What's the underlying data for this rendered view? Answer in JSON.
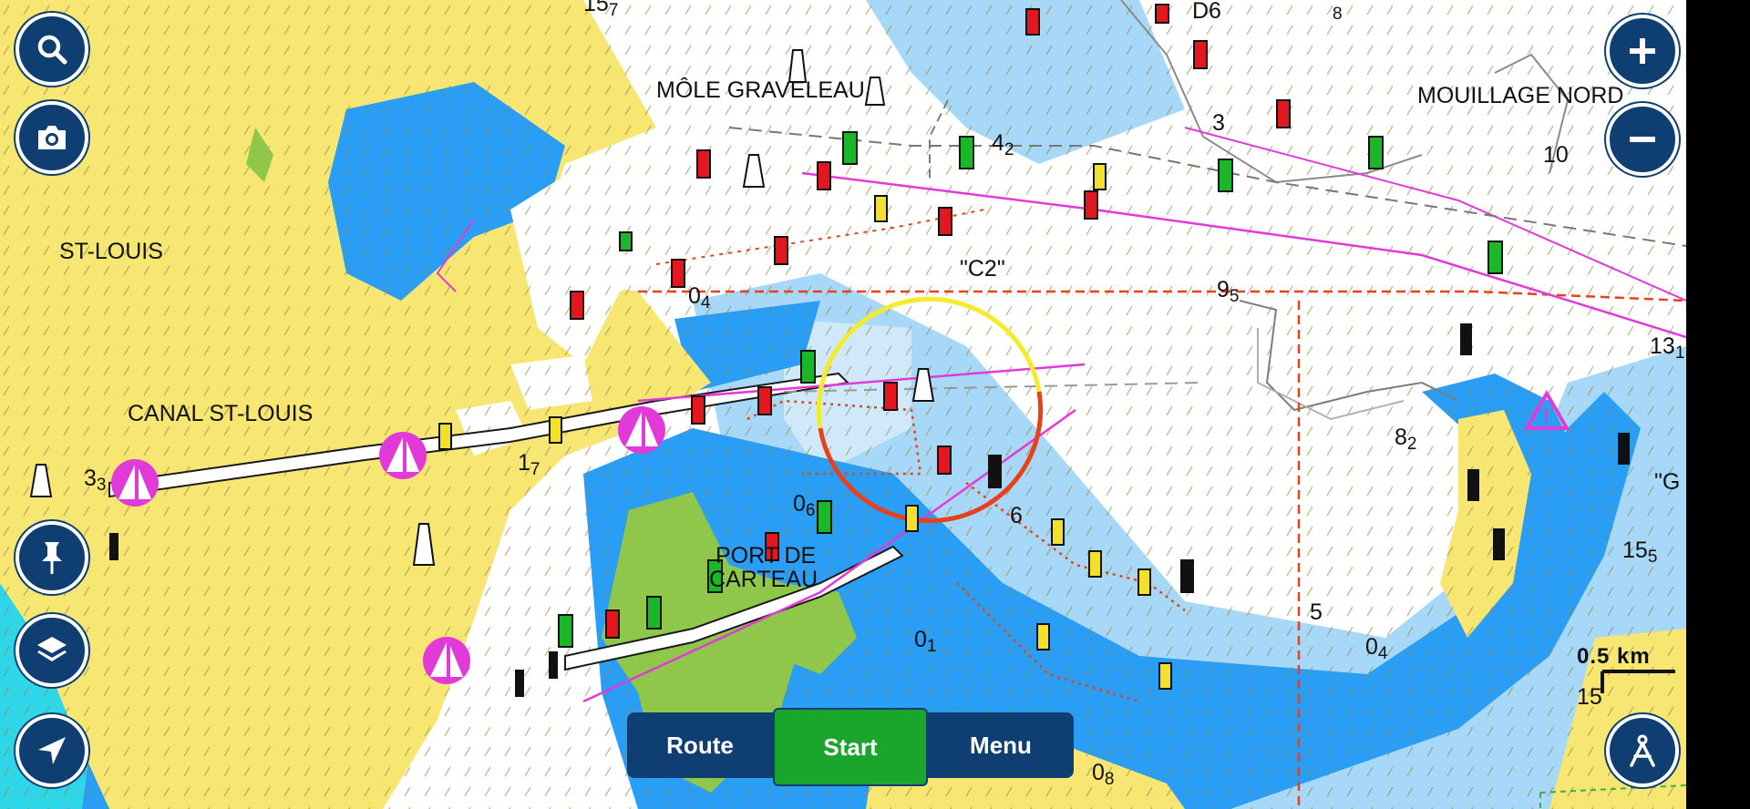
{
  "colors": {
    "land": "#f8e673",
    "shallow_water": "#2a9df4",
    "mid_water": "#a7d8f8",
    "deep_water": "#ffffff",
    "intertidal": "#8fc74a",
    "canal_cyan": "#2fd6e8",
    "button_navy": "#0f3f72",
    "start_green": "#1aa52c",
    "magenta": "#e23ad9",
    "buoy_red": "#e3171f",
    "buoy_green": "#1cb62b",
    "buoy_yellow": "#f2e02a",
    "danger_circle_yellow": "#f4ec2a",
    "danger_circle_red": "#e8401b"
  },
  "place_labels": {
    "mole_graveleau": "MÔLE GRAVELEAU",
    "mouillage_nord": "MOUILLAGE NORD",
    "st_louis": "ST-LOUIS",
    "canal_st_louis": "CANAL ST-LOUIS",
    "port_de_carteau_1": "PORT DE",
    "port_de_carteau_2": "CARTEAU",
    "c2_marker": "\"C2\"",
    "g_marker": "\"G",
    "d6_marker": "D6"
  },
  "soundings": [
    {
      "main": "15",
      "sub": "7"
    },
    {
      "main": "",
      "sub": "8"
    },
    {
      "main": "4",
      "sub": "2"
    },
    {
      "main": "3",
      "sub": ""
    },
    {
      "main": "10",
      "sub": ""
    },
    {
      "main": "0",
      "sub": "4"
    },
    {
      "main": "9",
      "sub": "5"
    },
    {
      "main": "13",
      "sub": "1"
    },
    {
      "main": "8",
      "sub": "2"
    },
    {
      "main": "3",
      "sub": "3"
    },
    {
      "main": "1",
      "sub": "7"
    },
    {
      "main": "0",
      "sub": "6"
    },
    {
      "main": "6",
      "sub": ""
    },
    {
      "main": "15",
      "sub": "5"
    },
    {
      "main": "5",
      "sub": ""
    },
    {
      "main": "0",
      "sub": "1"
    },
    {
      "main": "0",
      "sub": "4"
    },
    {
      "main": "15",
      "sub": ""
    },
    {
      "main": "0",
      "sub": "8"
    }
  ],
  "controls": {
    "search": "search-icon",
    "camera": "camera-icon",
    "pin": "pin-icon",
    "layers": "layers-icon",
    "locate": "navigation-arrow-icon",
    "zoom_in": "plus-icon",
    "zoom_out": "minus-icon",
    "settings": "compass-person-icon"
  },
  "bottom_bar": {
    "route_label": "Route",
    "start_label": "Start",
    "menu_label": "Menu"
  },
  "scale_bar": {
    "label": "0.5 km"
  }
}
